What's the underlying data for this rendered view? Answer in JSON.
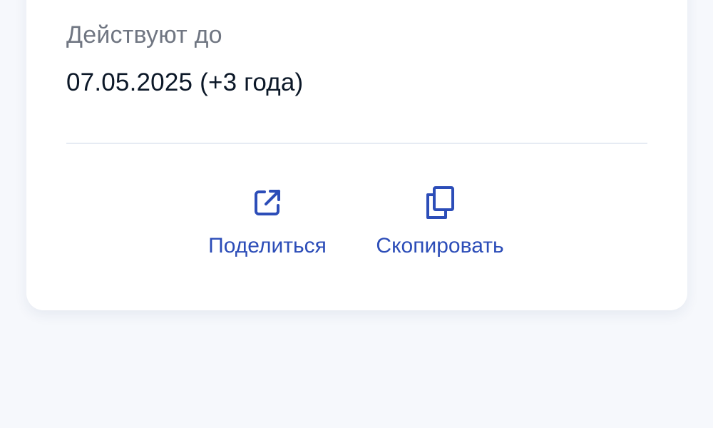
{
  "validity": {
    "label": "Действуют до",
    "value": "07.05.2025 (+3 года)"
  },
  "actions": {
    "share": {
      "label": "Поделиться",
      "icon": "share-icon"
    },
    "copy": {
      "label": "Скопировать",
      "icon": "copy-icon"
    }
  },
  "colors": {
    "accent": "#2c4db8",
    "background": "#f6f8fc",
    "card": "#ffffff",
    "label_text": "#707682",
    "value_text": "#0c1828",
    "divider": "#e6ebf3"
  }
}
